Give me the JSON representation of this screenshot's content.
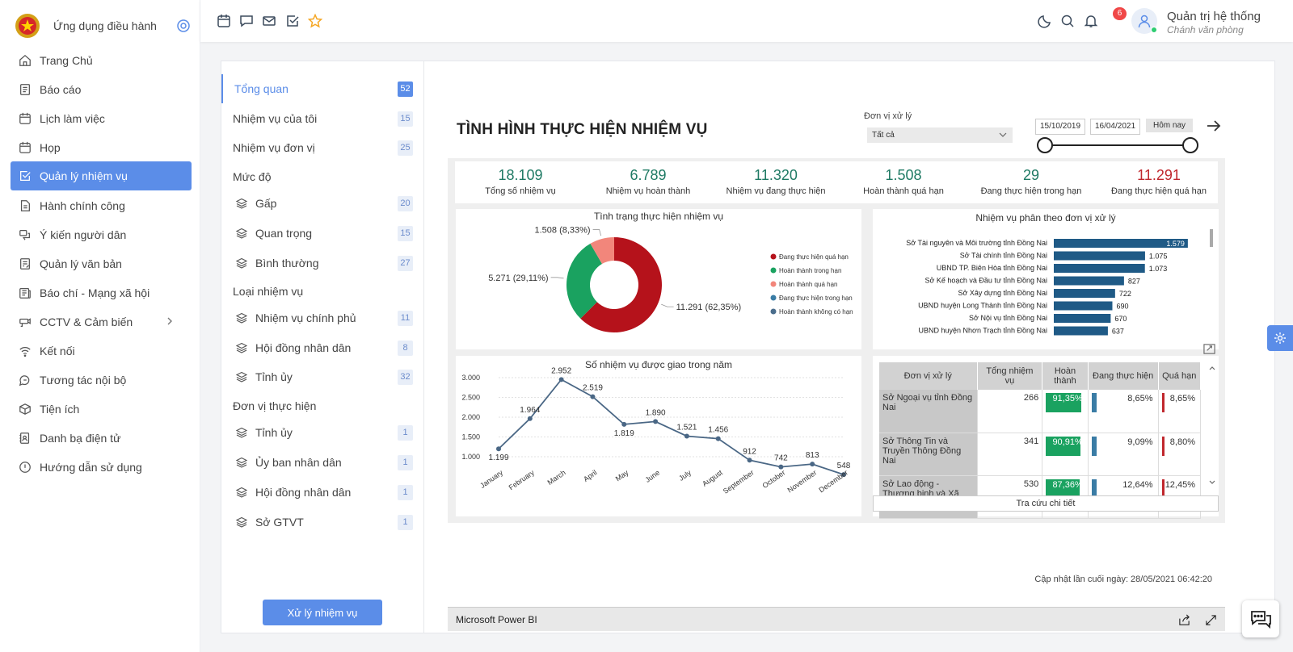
{
  "app": {
    "title": "Ứng dụng điều hành"
  },
  "sidebar": {
    "items": [
      {
        "label": "Trang Chủ"
      },
      {
        "label": "Báo cáo"
      },
      {
        "label": "Lịch làm việc"
      },
      {
        "label": "Họp"
      },
      {
        "label": "Quản lý nhiệm vụ"
      },
      {
        "label": "Hành chính công"
      },
      {
        "label": "Ý kiến người dân"
      },
      {
        "label": "Quản lý văn bản"
      },
      {
        "label": "Báo chí - Mạng xã hội"
      },
      {
        "label": "CCTV & Cảm biến"
      },
      {
        "label": "Kết nối"
      },
      {
        "label": "Tương tác nội bộ"
      },
      {
        "label": "Tiện ích"
      },
      {
        "label": "Danh bạ điện tử"
      },
      {
        "label": "Hướng dẫn sử dụng"
      }
    ],
    "active_index": 4
  },
  "topbar": {
    "notification_count": "6",
    "user_name": "Quản trị hệ thống",
    "user_role": "Chánh văn phòng"
  },
  "filter": {
    "overview": {
      "label": "Tổng quan",
      "count": "52"
    },
    "my_tasks": {
      "label": "Nhiệm vụ của tôi",
      "count": "15"
    },
    "unit_tasks": {
      "label": "Nhiệm vụ đơn vị",
      "count": "25"
    },
    "level_title": "Mức độ",
    "levels": [
      {
        "label": "Gấp",
        "count": "20"
      },
      {
        "label": "Quan trọng",
        "count": "15"
      },
      {
        "label": "Bình thường",
        "count": "27"
      }
    ],
    "type_title": "Loại nhiệm vụ",
    "types": [
      {
        "label": "Nhiệm vụ chính phủ",
        "count": "11"
      },
      {
        "label": "Hội đồng nhân dân",
        "count": "8"
      },
      {
        "label": "Tỉnh ủy",
        "count": "32"
      }
    ],
    "exec_title": "Đơn vị thực hiện",
    "execs": [
      {
        "label": "Tỉnh ủy",
        "count": "1"
      },
      {
        "label": "Ủy ban nhân dân",
        "count": "1"
      },
      {
        "label": "Hội đồng nhân dân",
        "count": "1"
      },
      {
        "label": "Sở GTVT",
        "count": "1"
      }
    ],
    "process_button": "Xử lý nhiệm vụ"
  },
  "report": {
    "title": "TÌNH HÌNH THỰC HIỆN NHIỆM VỤ",
    "unit_label": "Đơn vị xử lý",
    "unit_value": "Tất cả",
    "date_from": "15/10/2019",
    "date_to": "16/04/2021",
    "today_button": "Hôm nay",
    "kpis": [
      {
        "value": "18.109",
        "label": "Tổng số nhiệm vụ",
        "color": "#1f7a64"
      },
      {
        "value": "6.789",
        "label": "Nhiệm vụ hoàn thành",
        "color": "#1f7a64"
      },
      {
        "value": "11.320",
        "label": "Nhiệm vụ đang thực hiện",
        "color": "#1f7a64"
      },
      {
        "value": "1.508",
        "label": "Hoàn thành quá hạn",
        "color": "#1f7a64"
      },
      {
        "value": "29",
        "label": "Đang thực hiện trong hạn",
        "color": "#1f7a64"
      },
      {
        "value": "11.291",
        "label": "Đang thực hiện quá hạn",
        "color": "#c0272d"
      }
    ],
    "detail_link": "Tra cứu chi tiết",
    "last_updated": "Cập nhật lần cuối ngày: 28/05/2021 06:42:20",
    "footer": "Microsoft Power BI"
  },
  "chart_data": [
    {
      "type": "pie",
      "title": "Tình trạng thực hiện nhiệm vụ",
      "legend_position": "right",
      "slices": [
        {
          "name": "Đang thực hiện quá hạn",
          "value": 11291,
          "label": "11.291 (62,35%)",
          "color": "#b5121b"
        },
        {
          "name": "Hoàn thành trong hạn",
          "value": 5271,
          "label": "5.271 (29,11%)",
          "color": "#1aa260"
        },
        {
          "name": "Hoàn thành quá hạn",
          "value": 1508,
          "label": "1.508 (8,33%)",
          "color": "#f2867b"
        },
        {
          "name": "Đang thực hiện trong hạn",
          "value": 0,
          "label": "",
          "color": "#3a7ca5"
        },
        {
          "name": "Hoàn thành không có hạn",
          "value": 0,
          "label": "",
          "color": "#4a6d8c"
        }
      ]
    },
    {
      "type": "bar",
      "orientation": "horizontal",
      "title": "Nhiệm vụ phân theo đơn vị xử lý",
      "categories": [
        "Sở Tài nguyên và Môi trường tỉnh Đồng Nai",
        "Sở Tài chính tỉnh Đồng Nai",
        "UBND TP. Biên Hòa tỉnh Đồng Nai",
        "Sở Kế hoạch và Đầu tư tỉnh Đồng Nai",
        "Sở Xây dựng tỉnh Đồng Nai",
        "UBND huyện Long Thành tỉnh Đồng Nai",
        "Sở Nội vụ tỉnh Đồng Nai",
        "UBND huyện Nhơn Trạch tỉnh Đồng Nai"
      ],
      "values": [
        1579,
        1075,
        1073,
        827,
        722,
        690,
        670,
        637
      ],
      "labels": [
        "1.579",
        "1.075",
        "1.073",
        "827",
        "722",
        "690",
        "670",
        "637"
      ],
      "color": "#1f5a86"
    },
    {
      "type": "line",
      "title": "Số nhiệm vụ được giao trong năm",
      "categories": [
        "January",
        "February",
        "March",
        "April",
        "May",
        "June",
        "July",
        "August",
        "September",
        "October",
        "November",
        "December"
      ],
      "values": [
        1199,
        1964,
        2952,
        2519,
        1819,
        1890,
        1521,
        1456,
        912,
        742,
        813,
        548
      ],
      "labels": [
        "1.199",
        "1.964",
        "2.952",
        "2.519",
        "1.819",
        "1.890",
        "1.521",
        "1.456",
        "912",
        "742",
        "813",
        "548"
      ],
      "y_ticks": [
        "1.000",
        "1.500",
        "2.000",
        "2.500",
        "3.000"
      ],
      "ylim": [
        500,
        3000
      ],
      "color": "#4a6785"
    },
    {
      "type": "table",
      "columns": [
        "Đơn vị xử lý",
        "Tổng nhiệm vụ",
        "Hoàn thành",
        "Đang thực hiện",
        "Quá hạn"
      ],
      "rows": [
        {
          "unit": "Sở Ngoại vụ tỉnh Đồng Nai",
          "total": "266",
          "done": "91,35%",
          "done_v": 91.35,
          "doing": "8,65%",
          "doing_v": 8.65,
          "late": "8,65%",
          "late_v": 8.65
        },
        {
          "unit": "Sở Thông Tin và Truyền Thông Đồng Nai",
          "total": "341",
          "done": "90,91%",
          "done_v": 90.91,
          "doing": "9,09%",
          "doing_v": 9.09,
          "late": "8,80%",
          "late_v": 8.8
        },
        {
          "unit": "Sở Lao động - Thương binh và Xã",
          "total": "530",
          "done": "87,36%",
          "done_v": 87.36,
          "doing": "12,64%",
          "doing_v": 12.64,
          "late": "12,45%",
          "late_v": 12.45
        }
      ],
      "colors": {
        "done": "#1aa260",
        "doing": "#3a7ca5",
        "late": "#c0272d"
      }
    }
  ]
}
